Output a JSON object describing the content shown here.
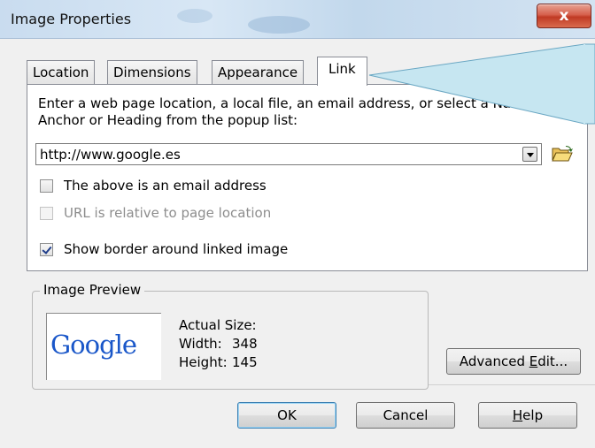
{
  "window": {
    "title": "Image Properties",
    "close_label": "x"
  },
  "tabs": [
    {
      "label": "Location",
      "active": false
    },
    {
      "label": "Dimensions",
      "active": false
    },
    {
      "label": "Appearance",
      "active": false
    },
    {
      "label": "Link",
      "active": true
    }
  ],
  "link": {
    "description": "Enter a web page location, a local file, an email address, or select a Named Anchor or Heading from the popup list:",
    "url_value": "http://www.google.es",
    "checkboxes": [
      {
        "label": "The above is an email address",
        "checked": false,
        "enabled": true
      },
      {
        "label": "URL is relative to page location",
        "checked": false,
        "enabled": false
      },
      {
        "label": "Show border around linked image",
        "checked": true,
        "enabled": true
      }
    ]
  },
  "preview": {
    "legend": "Image Preview",
    "logo_text": "Google",
    "actual_size_label": "Actual Size:",
    "width_label": "Width:",
    "width_value": "348",
    "height_label": "Height:",
    "height_value": "145"
  },
  "buttons": {
    "advanced_edit_prefix": "Advanced ",
    "advanced_edit_accel": "E",
    "advanced_edit_suffix": "dit...",
    "ok": "OK",
    "cancel": "Cancel",
    "help_accel": "H",
    "help_rest": "elp"
  },
  "icons": {
    "folder": "folder-open-icon",
    "dropdown": "chevron-down-icon"
  }
}
